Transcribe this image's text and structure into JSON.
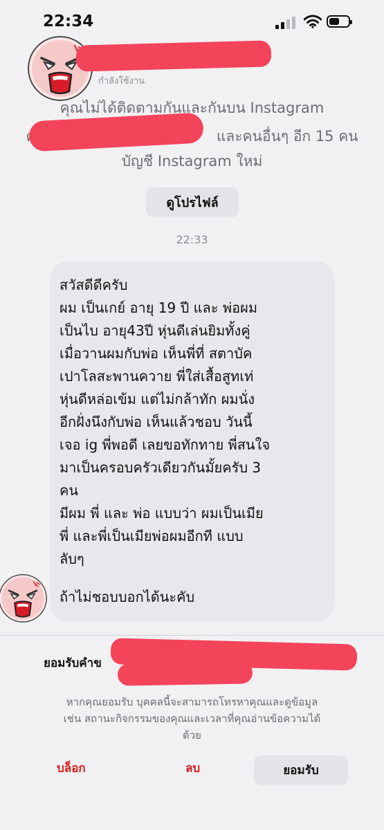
{
  "status_bar": {
    "time": "22:34",
    "battery_level": 0.55
  },
  "header": {
    "active_status": "กำลังใช้งาน"
  },
  "info": {
    "line1": "คุณไม่ได้ติดตามกันและกันบน Instagram",
    "line2_prefix": "คุ",
    "line2_suffix": "และคนอื่นๆ อีก 15 คน",
    "line3": "บัญชี Instagram ใหม่"
  },
  "profile_button_label": "ดูโปรไฟล์",
  "timestamp": "22:33",
  "message": {
    "lines": [
      "สวัสดีดีครับ",
      "ผม เป็นเกย์ อายุ 19 ปี และ พ่อผม",
      "เป็นไบ อายุ43ปี หุ่นดีเล่นยิมทั้งคู่",
      "เมื่อวานผมกับพ่อ เห็นพี่ที่ สตาบัค",
      "เปาโลสะพานควาย พี่ใส่เสื้อสูทเท่",
      "หุ่นดีหล่อเข้ม แต่ไม่กล้าทัก ผมนั่ง",
      "อีกฝั่งนึงกับพ่อ เห็นแล้วชอบ วันนี้",
      "เจอ ig พี่พอดี เลยขอทักทาย พี่สนใจ",
      "มาเป็นครอบครัวเดียวกันมั้ยครับ 3",
      "คน",
      "มีผม พี่ และ พ่อ  แบบว่า ผมเป็นเมีย",
      "พี่ และพี่เป็นเมียพ่อผมอีกที แบบ",
      "ลับๆ"
    ],
    "closing": "ถ้าไม่ชอบบอกได้นะคับ"
  },
  "request": {
    "title": "ยอมรับคำข",
    "desc_line1": "หากคุณยอมรับ บุคคลนี้จะสามารถโทรหาคุณและดูข้อมูล",
    "desc_line2": "เช่น สถานะกิจกรรมของคุณและเวลาที่คุณอ่านข้อความได้",
    "desc_line3": "ด้วย"
  },
  "actions": {
    "block": "บล็อก",
    "delete": "ลบ",
    "accept": "ยอมรับ"
  },
  "colors": {
    "redaction": "#f4445a",
    "danger": "#d81b1b",
    "bubble": "#e8e8ec"
  }
}
